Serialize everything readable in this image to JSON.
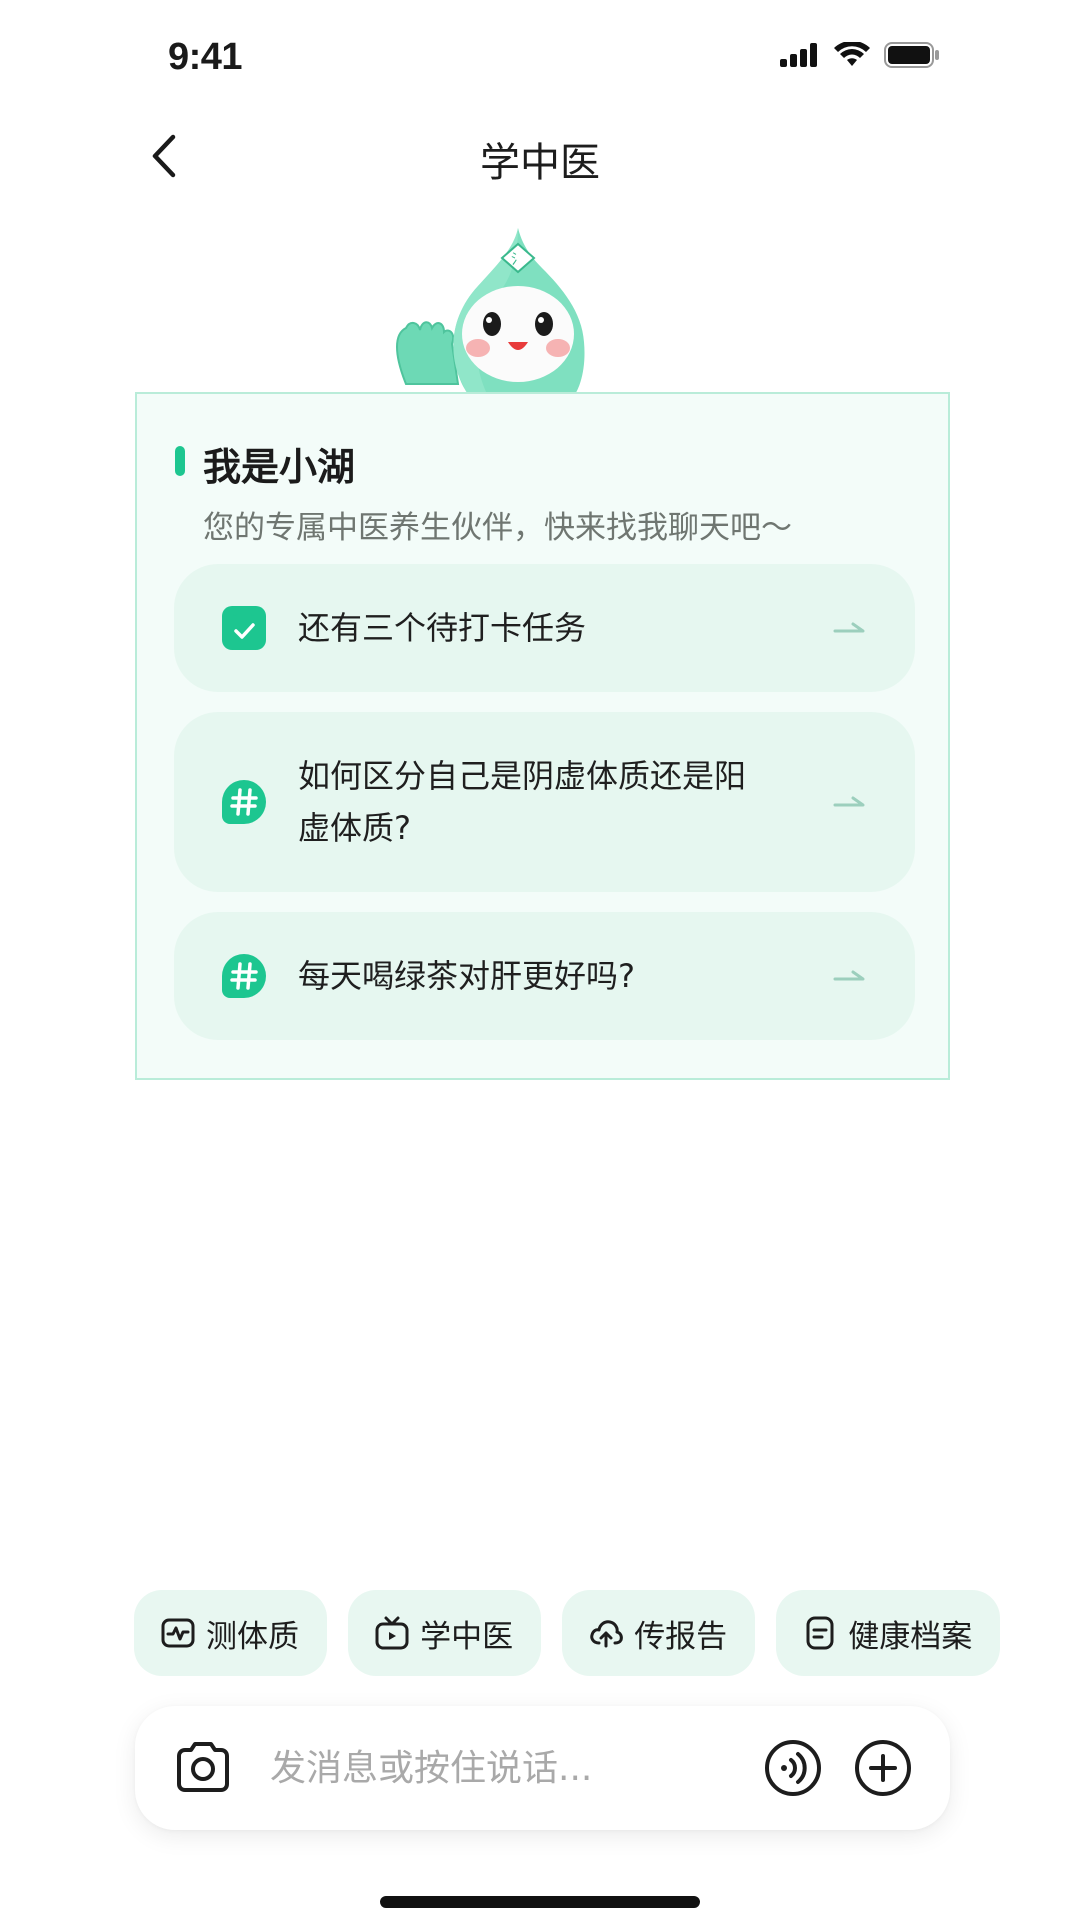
{
  "status_bar": {
    "time": "9:41"
  },
  "header": {
    "title": "学中医"
  },
  "card": {
    "title": "我是小湖",
    "subtitle": "您的专属中医养生伙伴，快来找我聊天吧～",
    "suggestions": [
      {
        "icon": "calendar-check-icon",
        "text": "还有三个待打卡任务"
      },
      {
        "icon": "hashtag-icon",
        "text": "如何区分自己是阴虚体质还是阳虚体质?"
      },
      {
        "icon": "hashtag-icon",
        "text": "每天喝绿茶对肝更好吗?"
      }
    ]
  },
  "quick_actions": [
    {
      "icon": "pulse-monitor-icon",
      "label": "测体质"
    },
    {
      "icon": "tv-icon",
      "label": "学中医"
    },
    {
      "icon": "cloud-upload-icon",
      "label": "传报告"
    },
    {
      "icon": "document-icon",
      "label": "健康档案"
    }
  ],
  "input_bar": {
    "placeholder": "发消息或按住说话..."
  },
  "colors": {
    "accent": "#1dc690",
    "card_bg": "#f3fcf9",
    "card_border": "#b9ecd9",
    "chip_bg": "#e8f7f1"
  }
}
